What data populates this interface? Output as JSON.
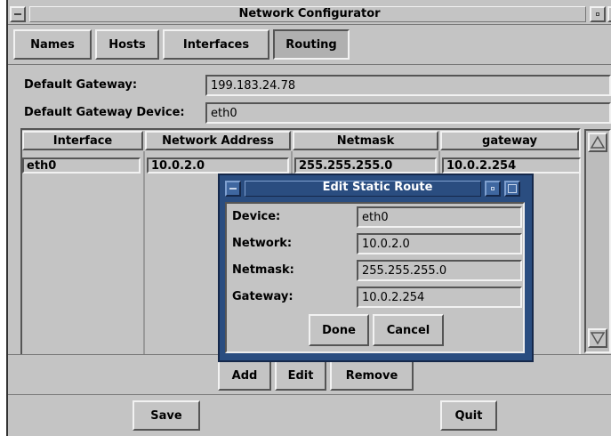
{
  "window": {
    "title": "Network Configurator"
  },
  "tabs": [
    {
      "label": "Names"
    },
    {
      "label": "Hosts"
    },
    {
      "label": "Interfaces"
    },
    {
      "label": "Routing"
    }
  ],
  "active_tab": "Routing",
  "gateway": {
    "label": "Default Gateway:",
    "value": "199.183.24.78",
    "device_label": "Default Gateway Device:",
    "device_value": "eth0"
  },
  "table": {
    "headers": [
      "Interface",
      "Network Address",
      "Netmask",
      "gateway"
    ],
    "rows": [
      {
        "interface": "eth0",
        "network": "10.0.2.0",
        "netmask": "255.255.255.0",
        "gateway": "10.0.2.254"
      }
    ]
  },
  "route_buttons": {
    "add": "Add",
    "edit": "Edit",
    "remove": "Remove"
  },
  "footer": {
    "save": "Save",
    "quit": "Quit"
  },
  "dialog": {
    "title": "Edit Static Route",
    "device_label": "Device:",
    "device_value": "eth0",
    "network_label": "Network:",
    "network_value": "10.0.2.0",
    "netmask_label": "Netmask:",
    "netmask_value": "255.255.255.0",
    "gateway_label": "Gateway:",
    "gateway_value": "10.0.2.254",
    "done": "Done",
    "cancel": "Cancel"
  },
  "colors": {
    "window_bg": "#c4c4c4",
    "dialog_frame": "#2a4d80",
    "dialog_title_text": "#ffffff"
  },
  "icons": [
    "window-menu-icon",
    "minimize-icon",
    "maximize-icon",
    "scroll-up-arrow-icon",
    "scroll-down-arrow-icon"
  ]
}
